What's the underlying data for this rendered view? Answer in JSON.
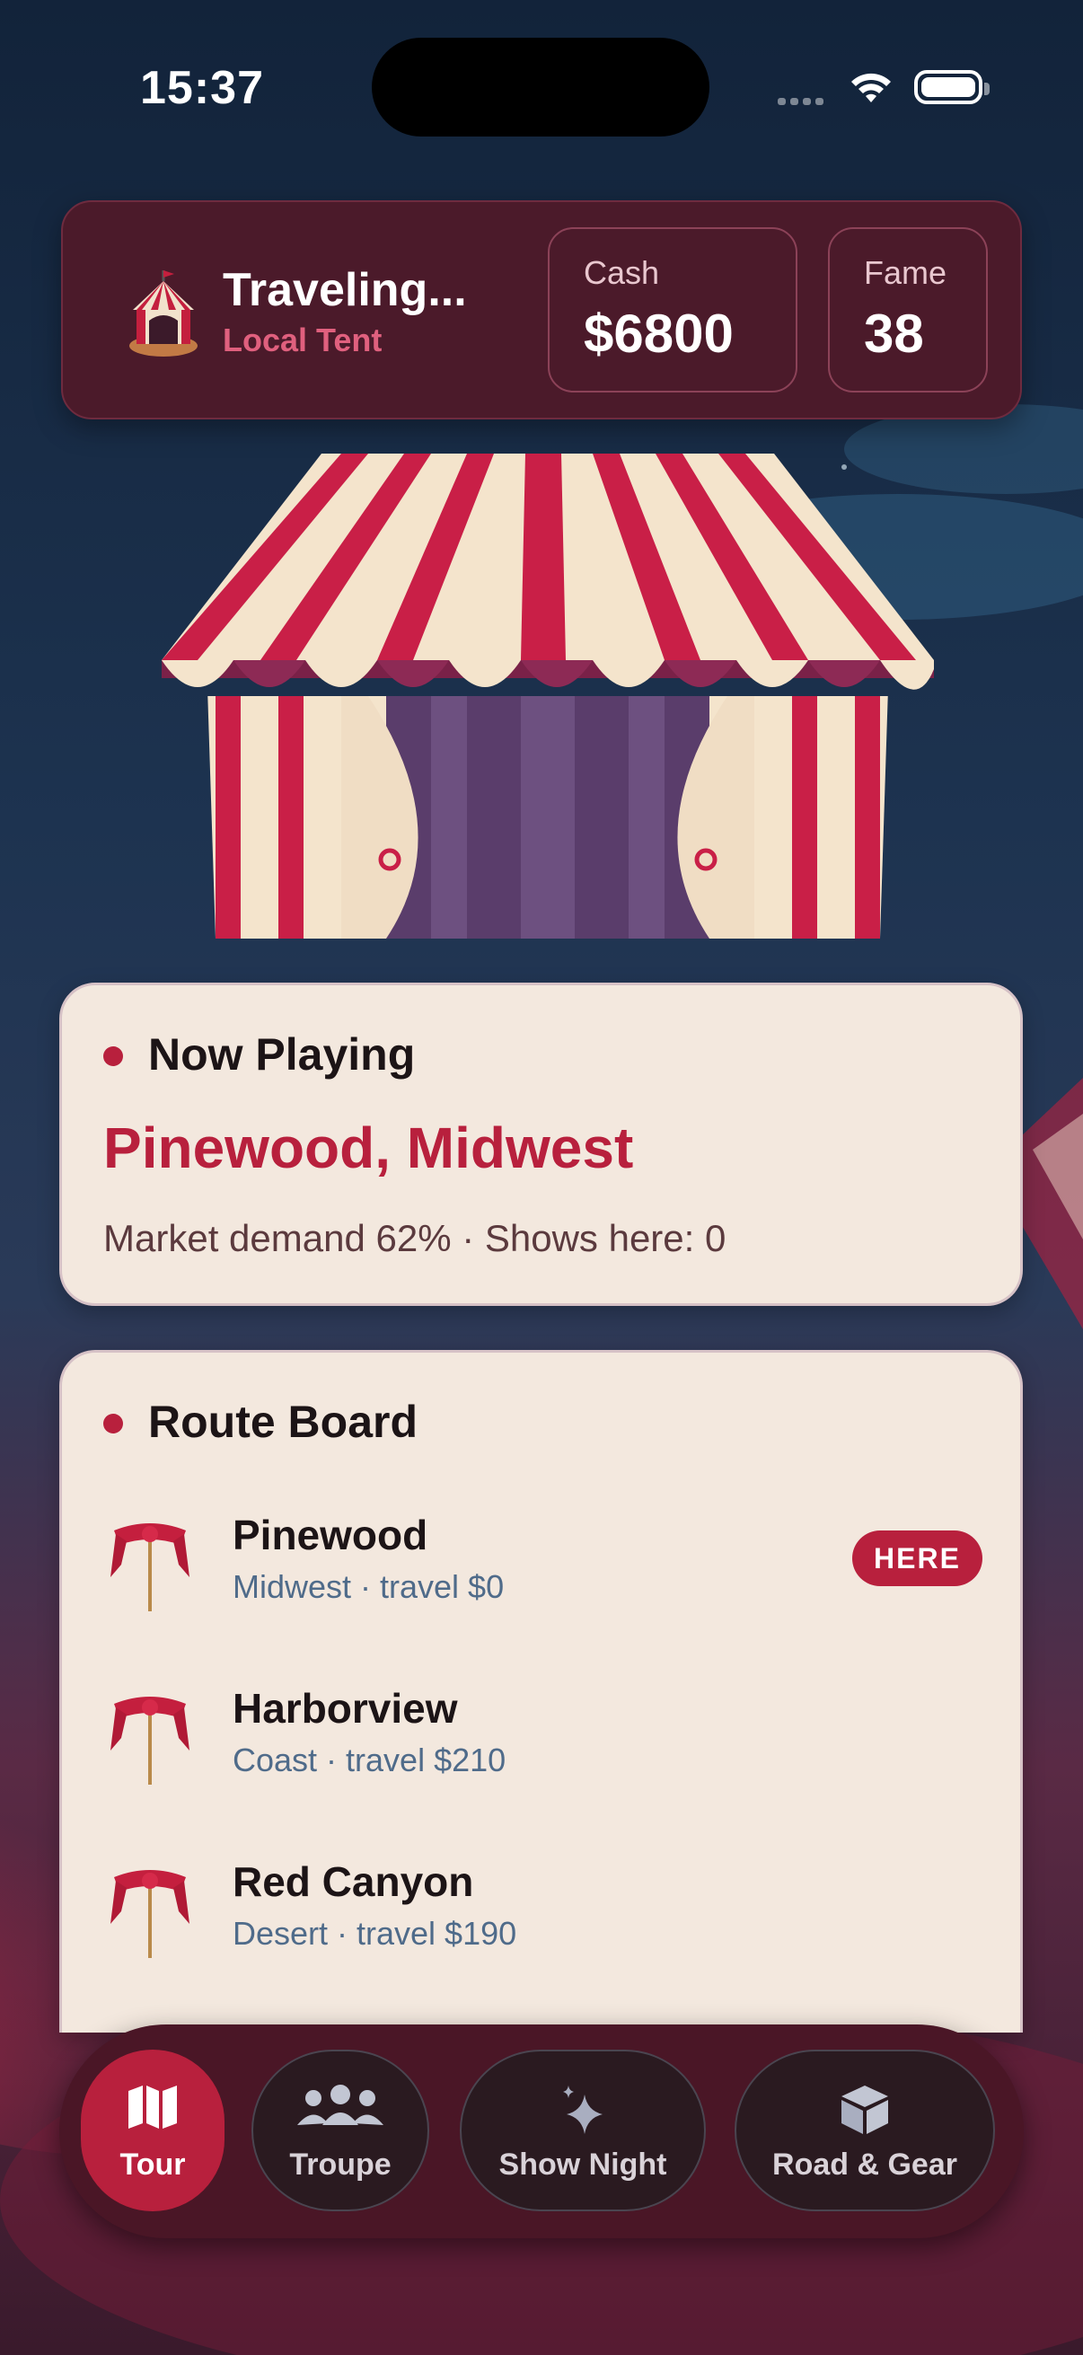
{
  "status_bar": {
    "time": "15:37"
  },
  "header": {
    "title": "Traveling...",
    "subtitle": "Local Tent",
    "cash_label": "Cash",
    "cash_value": "$6800",
    "fame_label": "Fame",
    "fame_value": "38"
  },
  "now_playing": {
    "heading": "Now Playing",
    "city": "Pinewood, Midwest",
    "meta": "Market demand 62% · Shows here: 0"
  },
  "route_board": {
    "heading": "Route Board",
    "stops": [
      {
        "name": "Pinewood",
        "meta": "Midwest · travel $0",
        "badge": "HERE"
      },
      {
        "name": "Harborview",
        "meta": "Coast · travel $210"
      },
      {
        "name": "Red Canyon",
        "meta": "Desert · travel $190"
      }
    ]
  },
  "tabs": [
    {
      "label": "Tour",
      "icon": "map-icon",
      "active": true
    },
    {
      "label": "Troupe",
      "icon": "people-icon"
    },
    {
      "label": "Show Night",
      "icon": "sparkles-icon"
    },
    {
      "label": "Road & Gear",
      "icon": "box-icon"
    }
  ],
  "colors": {
    "accent": "#b8203d",
    "panel": "#4b1a2a",
    "card": "#f3e8de"
  }
}
